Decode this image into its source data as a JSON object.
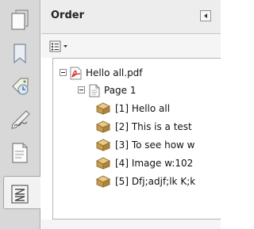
{
  "panel": {
    "title": "Order"
  },
  "sidebar": {
    "buttons": [
      {
        "icon": "pages-icon"
      },
      {
        "icon": "bookmark-icon"
      },
      {
        "icon": "attachments-icon"
      },
      {
        "icon": "signatures-icon"
      },
      {
        "icon": "content-icon"
      },
      {
        "icon": "order-icon",
        "active": true
      }
    ]
  },
  "toolbar": {
    "options_icon": "options-menu-icon"
  },
  "tree": {
    "root": {
      "label": "Hello all.pdf"
    },
    "page": {
      "label": "Page 1"
    },
    "items": [
      {
        "label": "[1]  Hello all"
      },
      {
        "label": "[2]  This is a test"
      },
      {
        "label": "[3]  To see how w"
      },
      {
        "label": "[4]  Image   w:102"
      },
      {
        "label": "[5]  Dfj;adjf;lk K;k"
      }
    ]
  }
}
